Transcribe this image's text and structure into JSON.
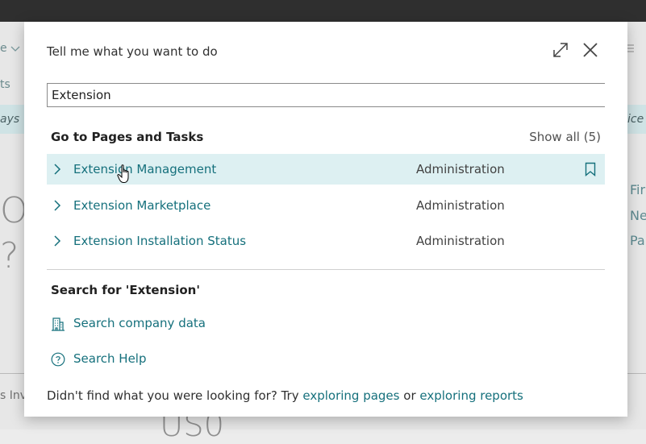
{
  "background": {
    "menu_fragment": "e",
    "item_fragment": "ts",
    "banner_left": "ays",
    "banner_right": "ice",
    "big_1": "O",
    "big_2": "?",
    "right_links": [
      "Fir",
      "Ne",
      "Pa"
    ],
    "bottom_left": "s Inv",
    "bottom_big": "US0"
  },
  "dialog": {
    "title": "Tell me what you want to do",
    "search": {
      "value": "Extension",
      "placeholder": ""
    },
    "pages_section": {
      "heading": "Go to Pages and Tasks",
      "show_all": "Show all (5)",
      "results": [
        {
          "name": "Extension Management",
          "category": "Administration"
        },
        {
          "name": "Extension Marketplace",
          "category": "Administration"
        },
        {
          "name": "Extension Installation Status",
          "category": "Administration"
        }
      ]
    },
    "search_section": {
      "heading": "Search for 'Extension'",
      "actions": [
        {
          "label": "Search company data",
          "icon": "building-icon"
        },
        {
          "label": "Search Help",
          "icon": "help-circle-icon"
        }
      ]
    },
    "footer": {
      "prefix": "Didn't find what you were looking for? Try",
      "link1": "exploring pages",
      "middle": "or",
      "link2": "exploring reports"
    }
  },
  "colors": {
    "accent": "#15707c",
    "selected_row": "#ddf0f2",
    "topbar": "#2f2f2f"
  }
}
